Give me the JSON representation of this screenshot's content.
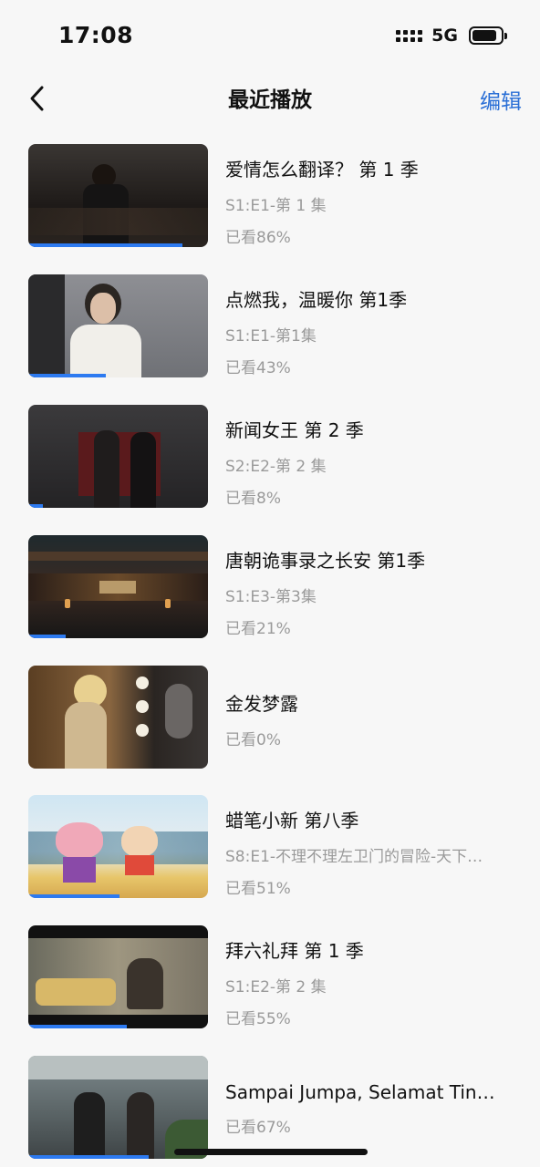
{
  "status": {
    "time": "17:08",
    "network": "5G"
  },
  "nav": {
    "title": "最近播放",
    "edit_label": "编辑"
  },
  "items": [
    {
      "title": "爱情怎么翻译？ 第 1 季",
      "episode": "S1:E1-第 1 集",
      "watched": "已看86%",
      "progress": 0.86
    },
    {
      "title": "点燃我，温暖你 第1季",
      "episode": "S1:E1-第1集",
      "watched": "已看43%",
      "progress": 0.43
    },
    {
      "title": "新闻女王 第 2 季",
      "episode": "S2:E2-第 2 集",
      "watched": "已看8%",
      "progress": 0.08
    },
    {
      "title": "唐朝诡事录之长安 第1季",
      "episode": "S1:E3-第3集",
      "watched": "已看21%",
      "progress": 0.21
    },
    {
      "title": "金发梦露",
      "episode": "",
      "watched": "已看0%",
      "progress": 0.0
    },
    {
      "title": "蜡笔小新 第八季",
      "episode": "S8:E1-不理不理左卫门的冒险-天下…",
      "watched": "已看51%",
      "progress": 0.51
    },
    {
      "title": "拜六礼拜 第 1 季",
      "episode": "S1:E2-第 2 集",
      "watched": "已看55%",
      "progress": 0.55
    },
    {
      "title": "Sampai Jumpa, Selamat Tin…",
      "episode": "",
      "watched": "已看67%",
      "progress": 0.67
    }
  ]
}
